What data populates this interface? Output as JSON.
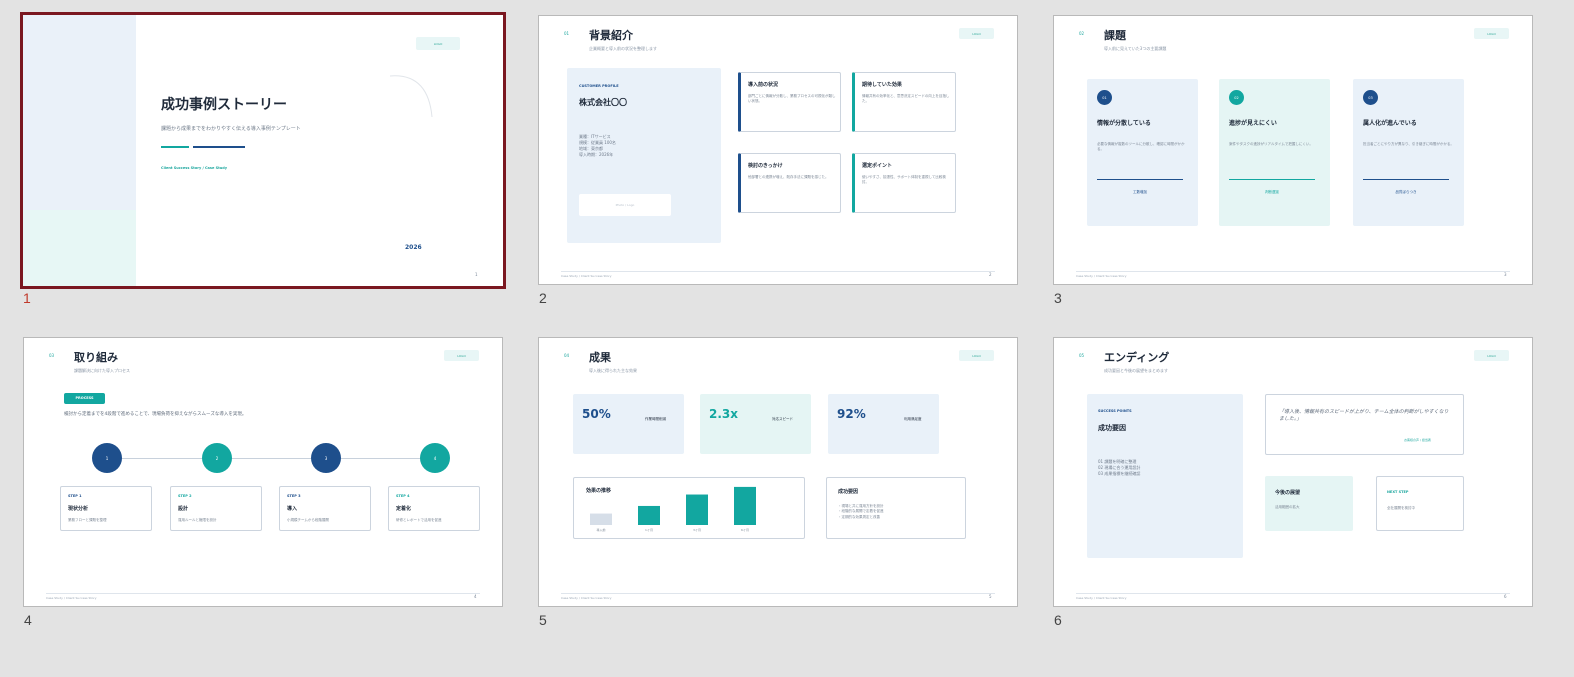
{
  "colors": {
    "navy": "#1e4f8c",
    "teal": "#12a7a0",
    "selected_border": "#7a1720",
    "bg": "#e3e3e3"
  },
  "slide_numbers": [
    "1",
    "2",
    "3",
    "4",
    "5",
    "6"
  ],
  "common": {
    "logo": "LOGO",
    "footer": "Case Study / Client Success Story"
  },
  "s1": {
    "title": "成功事例ストーリー",
    "subtitle": "課題から成果までをわかりやすく伝える導入事例テンプレート",
    "tagline": "Client Success Story / Case Study",
    "year": "2026",
    "page": "1"
  },
  "s2": {
    "sec": "01",
    "title": "背景紹介",
    "sub": "企業概要と導入前の状況を整理します",
    "profile_label": "CUSTOMER PROFILE",
    "company": "株式会社〇〇",
    "details": [
      "業種：ITサービス",
      "規模：従業員 100名",
      "地域：東京都",
      "導入時期：2026年"
    ],
    "photo": "Photo / Logo",
    "cards": [
      {
        "title": "導入前の状況",
        "body": "部門ごとに情報が分散し、業務プロセスの可視化が難しい状態。"
      },
      {
        "title": "期待していた効果",
        "body": "情報共有の効率化と、意思決定スピードの向上を目指した。"
      },
      {
        "title": "検討のきっかけ",
        "body": "他部署との連携が増え、既存手法に課題を感じた。"
      },
      {
        "title": "選定ポイント",
        "body": "使いやすさ、拡張性、サポート体制を重視して比較検討。"
      }
    ],
    "page": "2"
  },
  "s3": {
    "sec": "02",
    "title": "課題",
    "sub": "導入前に見えていた3つの主要課題",
    "cards": [
      {
        "n": "01",
        "title": "情報が分散している",
        "body": "必要な情報が複数のツールに分散し、確認に時間がかかる。",
        "foot": "工数増加"
      },
      {
        "n": "02",
        "title": "進捗が見えにくい",
        "body": "案件やタスクの進捗がリアルタイムで把握しにくい。",
        "foot": "判断遅延"
      },
      {
        "n": "03",
        "title": "属人化が進んでいる",
        "body": "担当者ごとにやり方が異なり、引き継ぎに時間がかかる。",
        "foot": "品質ばらつき"
      }
    ],
    "page": "3"
  },
  "s4": {
    "sec": "03",
    "title": "取り組み",
    "sub": "課題解決に向けた導入プロセス",
    "badge": "PROCESS",
    "lead": "検討から定着までを4段階で進めることで、現場負荷を抑えながらスムーズな導入を実現。",
    "steps": [
      {
        "n": "1",
        "step": "STEP 1",
        "title": "現状分析",
        "body": "業務フローと課題を整理"
      },
      {
        "n": "2",
        "step": "STEP 2",
        "title": "設計",
        "body": "運用ルールと権限を設計"
      },
      {
        "n": "3",
        "step": "STEP 3",
        "title": "導入",
        "body": "小規模チームから段階展開"
      },
      {
        "n": "4",
        "step": "STEP 4",
        "title": "定着化",
        "body": "研修とレポートで活用を促進"
      }
    ],
    "page": "4"
  },
  "s5": {
    "sec": "04",
    "title": "成果",
    "sub": "導入後に得られた主な効果",
    "kpis": [
      {
        "value": "50%",
        "label": "作業時間削減"
      },
      {
        "value": "2.3x",
        "label": "対応スピード"
      },
      {
        "value": "92%",
        "label": "利用満足度"
      }
    ],
    "chart_title": "効果の推移",
    "reason_title": "成功要因",
    "reasons": [
      "・現場と共に運用方針を設計",
      "・段階的な展開で定着を促進",
      "・定期的な効果測定と改善"
    ],
    "page": "5"
  },
  "s6": {
    "sec": "05",
    "title": "エンディング",
    "sub": "成功要因と今後の展望をまとめます",
    "points_label": "SUCCESS POINTS",
    "factor_title": "成功要因",
    "factors": [
      "01  課題を明確に整理",
      "02  現場に合う運用設計",
      "03  成果指標を継続確認"
    ],
    "quote": "「導入後、情報共有のスピードが上がり、チーム全体の判断がしやすくなりました。」",
    "quote_by": "お客様の声 / 担当者",
    "future_title": "今後の展望",
    "future_body": "活用範囲の拡大",
    "next_label": "NEXT STEP",
    "next_body": "全社展開を検討中",
    "page": "6"
  },
  "chart_data": {
    "type": "bar",
    "title": "効果の推移",
    "categories": [
      "導入前",
      "1ヶ月",
      "3ヶ月",
      "6ヶ月"
    ],
    "values": [
      12,
      20,
      32,
      40
    ],
    "ylim": [
      0,
      42
    ]
  }
}
